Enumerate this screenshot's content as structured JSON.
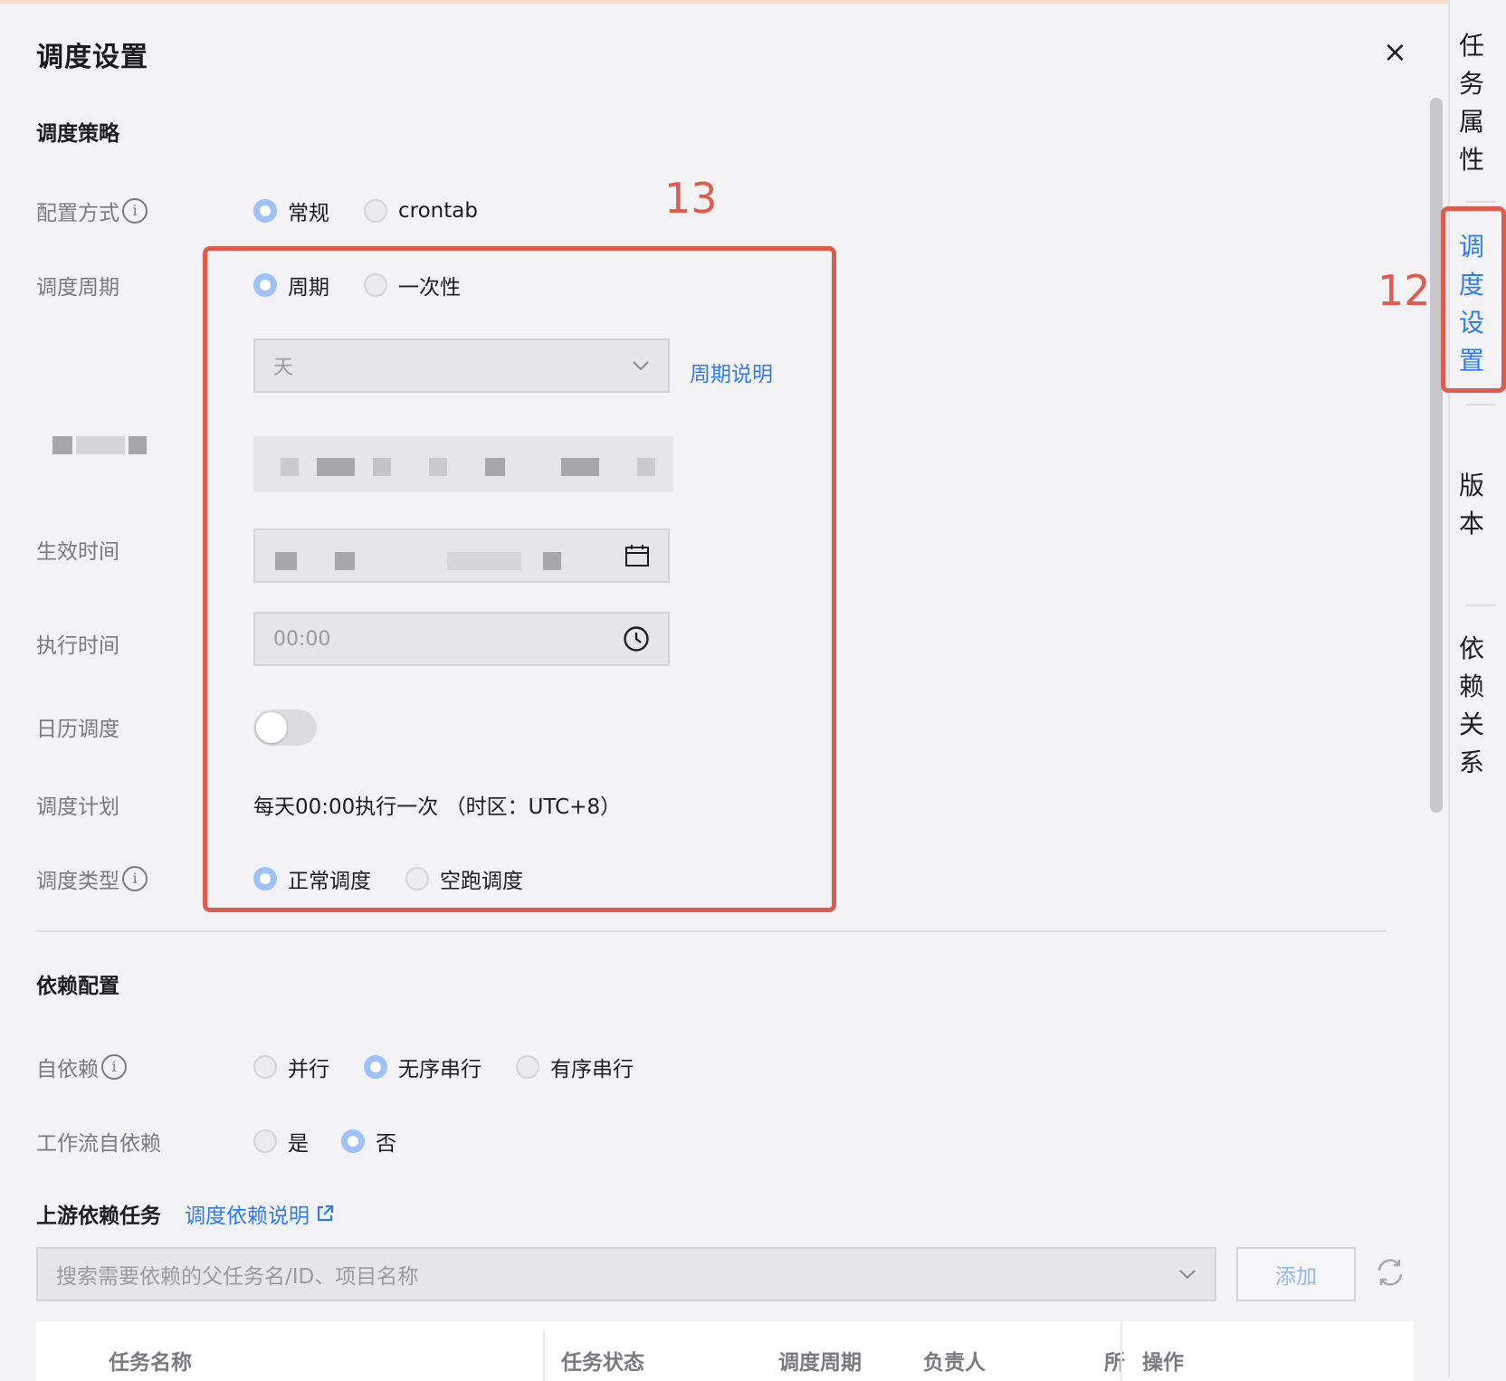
{
  "header": {
    "title": "调度设置",
    "close_icon": "×"
  },
  "schedule_policy": {
    "section_title": "调度策略",
    "config_mode": {
      "label": "配置方式",
      "options": [
        "常规",
        "crontab"
      ],
      "selected": "常规"
    },
    "cycle": {
      "label": "调度周期",
      "options": [
        "周期",
        "一次性"
      ],
      "selected": "周期"
    },
    "period_select": {
      "value": "天",
      "link": "周期说明"
    },
    "effective_time": {
      "label": "生效时间"
    },
    "exec_time": {
      "label": "执行时间",
      "value": "00:00"
    },
    "calendar": {
      "label": "日历调度",
      "enabled": false
    },
    "plan": {
      "label": "调度计划",
      "value": "每天00:00执行一次 （时区：UTC+8）"
    },
    "type": {
      "label": "调度类型",
      "options": [
        "正常调度",
        "空跑调度"
      ],
      "selected": "正常调度"
    }
  },
  "annotations": {
    "box13": "13",
    "box12": "12"
  },
  "dependency": {
    "section_title": "依赖配置",
    "self_dep": {
      "label": "自依赖",
      "options": [
        "并行",
        "无序串行",
        "有序串行"
      ],
      "selected": "无序串行"
    },
    "workflow_self_dep": {
      "label": "工作流自依赖",
      "options": [
        "是",
        "否"
      ],
      "selected": "否"
    },
    "upstream": {
      "title": "上游依赖任务",
      "link": "调度依赖说明"
    },
    "search_placeholder": "搜索需要依赖的父任务名/ID、项目名称",
    "add_button": "添加",
    "table_columns": [
      "任务名称",
      "任务状态",
      "调度周期",
      "负责人",
      "所",
      "操作"
    ]
  },
  "right_tabs": [
    "任务属性",
    "调度设置",
    "版本",
    "依赖关系"
  ],
  "colors": {
    "accent": "#2e7bf3",
    "annotation": "#e05a4e"
  }
}
